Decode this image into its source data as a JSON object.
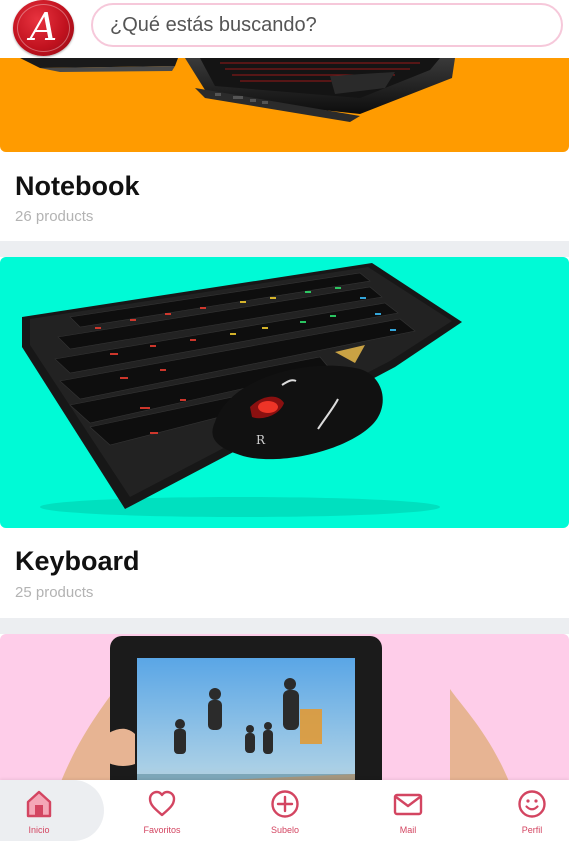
{
  "search": {
    "placeholder": "¿Qué estás buscando?"
  },
  "logo": {
    "letter": "A"
  },
  "categories": [
    {
      "title": "Notebook",
      "count": "26 products",
      "bg": "#ff9b00"
    },
    {
      "title": "Keyboard",
      "count": "25 products",
      "bg": "#00fad6"
    },
    {
      "title": "",
      "count": "",
      "bg": "#fecde9"
    }
  ],
  "nav": {
    "items": [
      {
        "label": "Inicio",
        "icon": "home-icon",
        "active": true
      },
      {
        "label": "Favoritos",
        "icon": "heart-icon"
      },
      {
        "label": "Subelo",
        "icon": "plus-circle-icon"
      },
      {
        "label": "Mail",
        "icon": "mail-icon"
      },
      {
        "label": "Perfil",
        "icon": "smile-icon"
      }
    ],
    "accent": "#d34561"
  }
}
